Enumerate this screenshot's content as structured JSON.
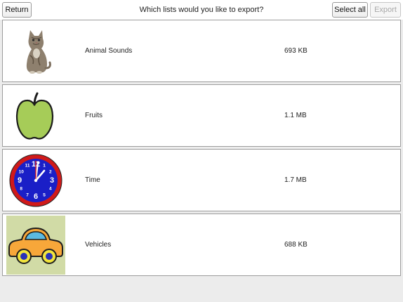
{
  "header": {
    "return_label": "Return",
    "title": "Which lists would you like to export?",
    "select_all_label": "Select all",
    "export_label": "Export"
  },
  "lists": [
    {
      "name": "Animal Sounds",
      "size": "693 KB",
      "icon": "cat-icon"
    },
    {
      "name": "Fruits",
      "size": "1.1 MB",
      "icon": "apple-icon"
    },
    {
      "name": "Time",
      "size": "1.7 MB",
      "icon": "clock-icon"
    },
    {
      "name": "Vehicles",
      "size": "688 KB",
      "icon": "car-icon"
    }
  ],
  "clock_numbers": [
    "12",
    "1",
    "2",
    "3",
    "4",
    "5",
    "6",
    "7",
    "8",
    "9",
    "10",
    "11"
  ],
  "colors": {
    "disabled_text": "#a8a8a8",
    "apple_green": "#a6cc58",
    "clock_face": "#1a1fc7",
    "clock_rim": "#d01a1a",
    "car_body": "#f7a73a",
    "car_bg": "#d1dba6"
  }
}
